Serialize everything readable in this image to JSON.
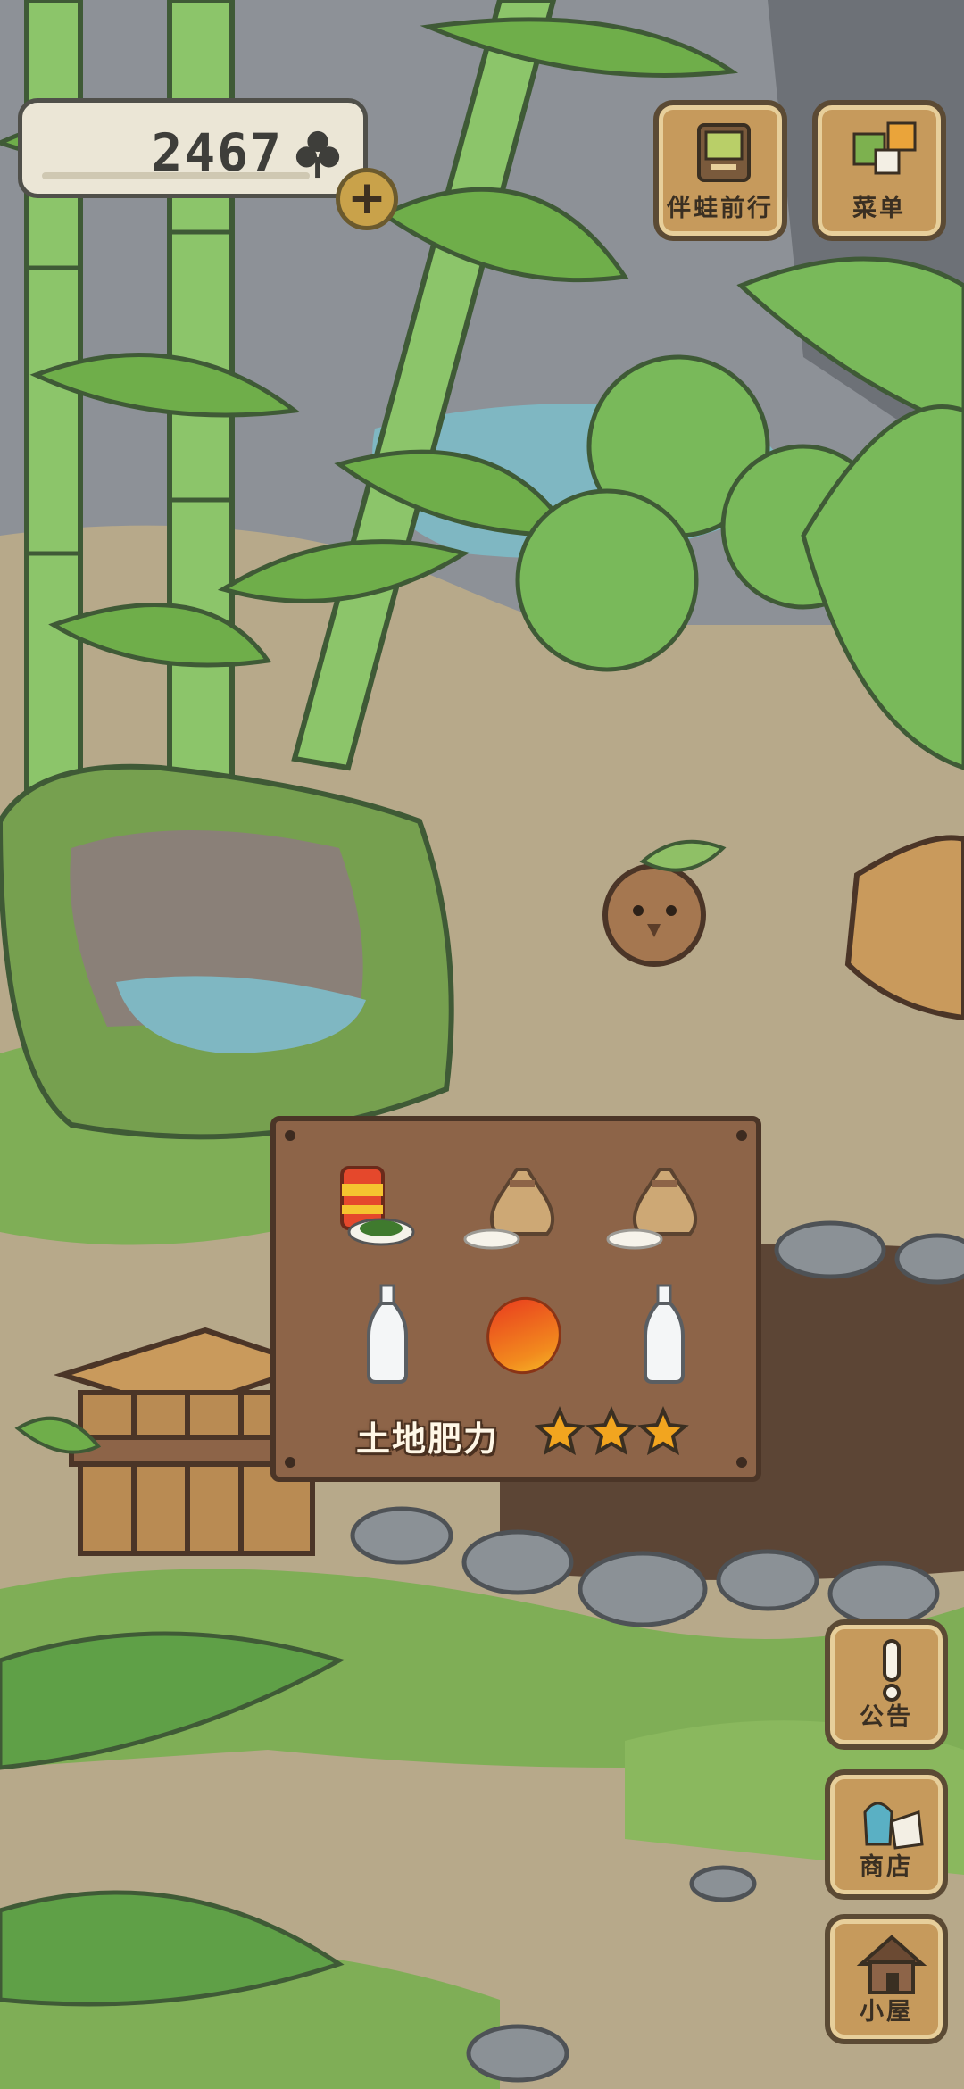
{
  "hud": {
    "clover_count": "2467",
    "add_label": "+"
  },
  "top_buttons": {
    "travel_label": "伴蛙前行",
    "menu_label": "菜单"
  },
  "side_buttons": {
    "notice_label": "公告",
    "shop_label": "商店",
    "hut_label": "小屋"
  },
  "garden_panel": {
    "items": [
      {
        "name": "canned-food",
        "icon": "can-with-salad"
      },
      {
        "name": "rice-bag",
        "icon": "rice-sack"
      },
      {
        "name": "rice-bag",
        "icon": "rice-sack"
      },
      {
        "name": "water-bottle",
        "icon": "glass-bottle"
      },
      {
        "name": "mango",
        "icon": "mango"
      },
      {
        "name": "water-bottle",
        "icon": "glass-bottle"
      }
    ],
    "fertility_label": "土地肥力",
    "fertility_stars": 3,
    "fertility_max_stars": 3
  },
  "colors": {
    "leaf": "#6fae4a",
    "wood": "#c69a5c",
    "path": "#b7a98a",
    "soil": "#5c4535",
    "star": "#f2a51f"
  }
}
